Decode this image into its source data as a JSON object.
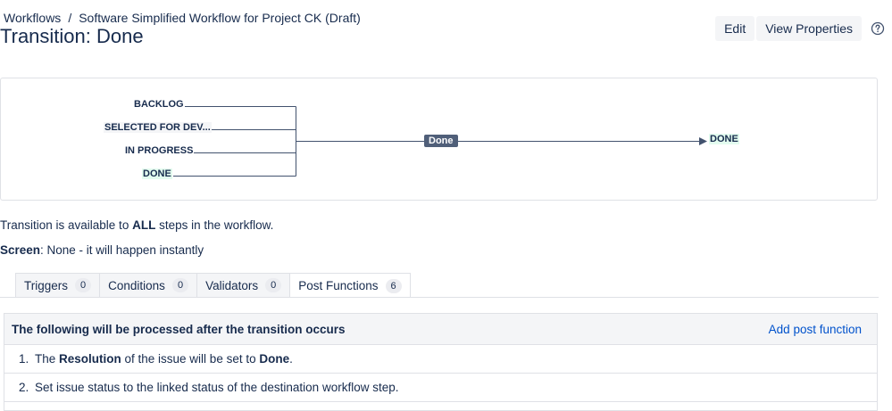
{
  "breadcrumb": {
    "root": "Workflows",
    "separator": "/",
    "workflow": "Software Simplified Workflow for Project CK (Draft)"
  },
  "page": {
    "title": "Transition: Done"
  },
  "actions": {
    "edit": "Edit",
    "view_properties": "View Properties",
    "help_icon": "question-circle-icon"
  },
  "diagram": {
    "sources": [
      "BACKLOG",
      "SELECTED FOR DEV...",
      "IN PROGRESS",
      "DONE"
    ],
    "transition": "Done",
    "destination": "DONE",
    "colors": {
      "line": "#42526e",
      "chip": "#505f79",
      "done_bg": "#e3fcef"
    }
  },
  "info": {
    "availability": {
      "prefix": "Transition is available to ",
      "strong": "ALL",
      "suffix": " steps in the workflow."
    },
    "screen": {
      "label": "Screen",
      "text": ": None - it will happen instantly"
    }
  },
  "tabs": [
    {
      "label": "Triggers",
      "count": "0"
    },
    {
      "label": "Conditions",
      "count": "0"
    },
    {
      "label": "Validators",
      "count": "0"
    },
    {
      "label": "Post Functions",
      "count": "6"
    }
  ],
  "post_functions": {
    "header": "The following will be processed after the transition occurs",
    "add_link": "Add post function",
    "items": [
      {
        "num": "1.",
        "t1": "The ",
        "b1": "Resolution",
        "t2": " of the issue will be set to ",
        "b2": "Done",
        "t3": "."
      },
      {
        "num": "2.",
        "text": "Set issue status to the linked status of the destination workflow step."
      }
    ]
  },
  "colors": {
    "link": "#0052cc",
    "text": "#172b4d",
    "border": "#dfe1e6",
    "panel_bg": "#f4f5f7"
  }
}
